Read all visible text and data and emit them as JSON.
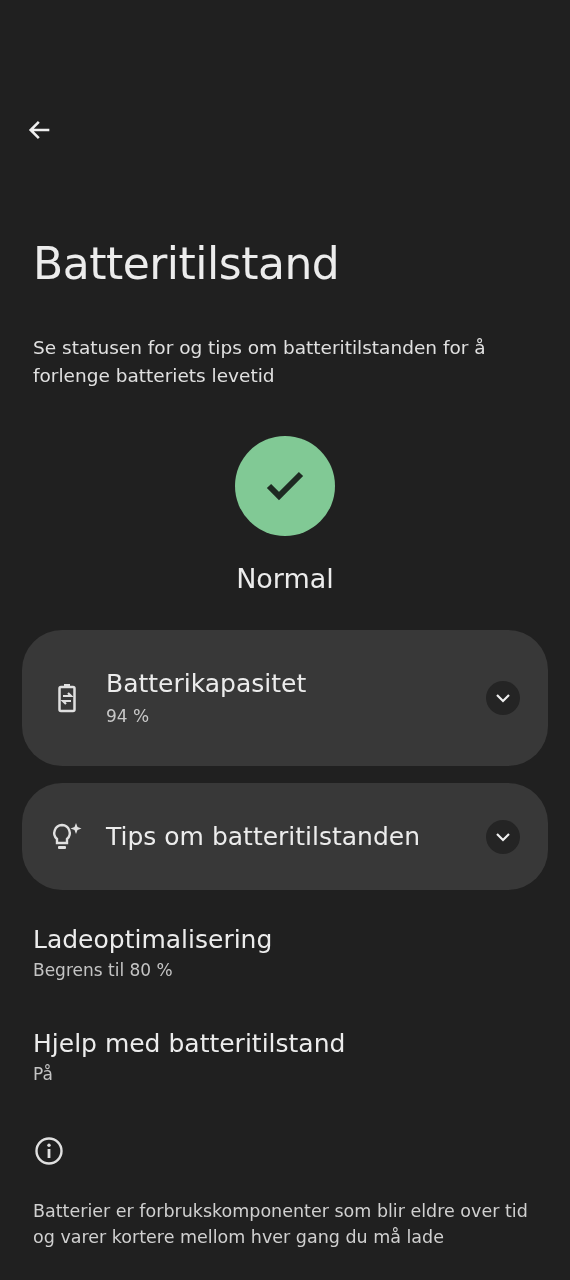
{
  "title": "Batteritilstand",
  "description": "Se statusen for og tips om batteritilstanden for å forlenge batteriets levetid",
  "status": {
    "label": "Normal",
    "color": "#81c995"
  },
  "cards": [
    {
      "kind": "battery",
      "title": "Batterikapasitet",
      "subtitle": "94 %",
      "expanded": false
    },
    {
      "kind": "tips",
      "title": "Tips om batteritilstanden",
      "expanded": false
    }
  ],
  "settings": [
    {
      "title": "Ladeoptimalisering",
      "subtitle": "Begrens til 80 %"
    },
    {
      "title": "Hjelp med batteritilstand",
      "subtitle": "På"
    }
  ],
  "footer": "Batterier er forbrukskomponenter som blir eldre over tid og varer kortere mellom hver gang du må lade"
}
